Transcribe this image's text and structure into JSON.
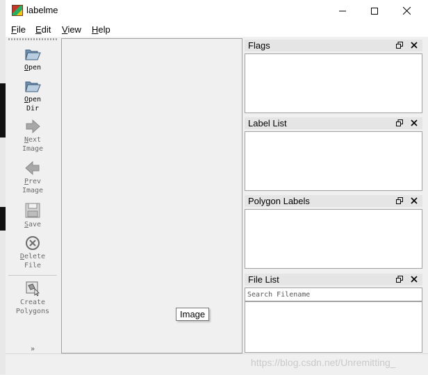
{
  "window": {
    "title": "labelme"
  },
  "menubar": {
    "items": [
      {
        "underline": "F",
        "rest": "ile"
      },
      {
        "underline": "E",
        "rest": "dit"
      },
      {
        "underline": "V",
        "rest": "iew"
      },
      {
        "underline": "H",
        "rest": "elp"
      }
    ]
  },
  "toolbar": {
    "open": {
      "u": "O",
      "rest": "pen"
    },
    "open_dir": {
      "u": "O",
      "rest": "pen",
      "line2": "Dir"
    },
    "next_image": {
      "u": "N",
      "rest": "ext",
      "line2": "Image"
    },
    "prev_image": {
      "u": "P",
      "rest": "rev",
      "line2": "Image"
    },
    "save": {
      "u": "S",
      "rest": "ave"
    },
    "delete_file": {
      "u": "D",
      "rest": "elete",
      "line2": "File"
    },
    "create_polygons": {
      "line1": "Create",
      "line2": "Polygons"
    },
    "more": "»"
  },
  "canvas": {
    "tooltip": "Image"
  },
  "docks": {
    "flags": {
      "title": "Flags"
    },
    "label_list": {
      "title": "Label List"
    },
    "polygon_labels": {
      "title": "Polygon Labels"
    },
    "file_list": {
      "title": "File List",
      "search_placeholder": "Search Filename"
    }
  },
  "statusbar": {
    "watermark": "https://blog.csdn.net/Unremitting_"
  }
}
